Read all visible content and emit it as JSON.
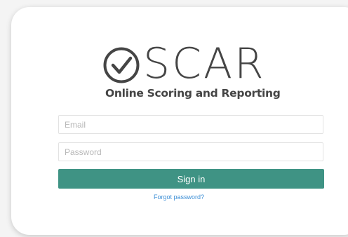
{
  "logo": {
    "wordmark": "SCAR",
    "tagline": "Online Scoring and Reporting"
  },
  "form": {
    "email_placeholder": "Email",
    "password_placeholder": "Password",
    "signin_label": "Sign in",
    "forgot_label": "Forgot password?"
  },
  "colors": {
    "primary_button": "#3f9384",
    "link": "#3d8fd6",
    "logo_text": "#454545"
  }
}
